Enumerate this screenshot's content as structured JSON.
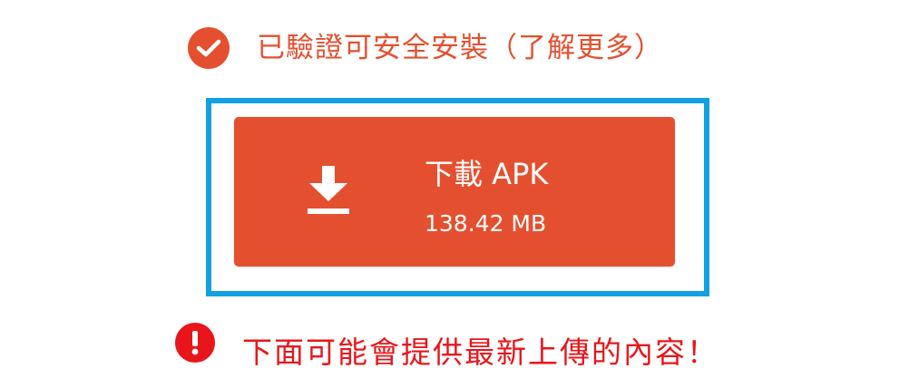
{
  "colors": {
    "brand_orange": "#e4502f",
    "warning_red": "#e8161b",
    "highlight_blue": "#12a1e0"
  },
  "verified": {
    "icon": "check-circle-icon",
    "text": "已驗證可安全安裝（了解更多）"
  },
  "download": {
    "icon": "download-icon",
    "label": "下載 APK",
    "size": "138.42 MB"
  },
  "warning": {
    "icon": "exclamation-circle-icon",
    "text": "下面可能會提供最新上傳的內容！"
  }
}
